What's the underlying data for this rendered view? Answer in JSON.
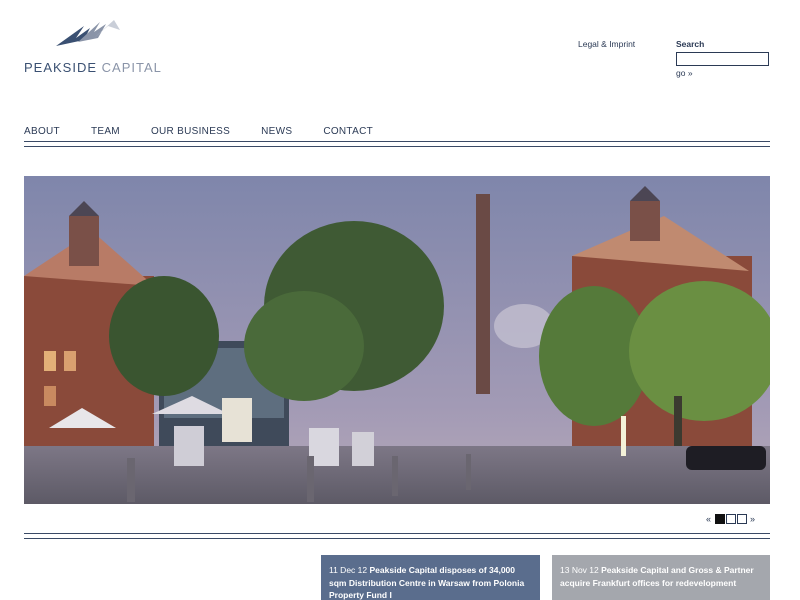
{
  "brand": {
    "name_main": "PEAKSIDE",
    "name_sub": "CAPITAL",
    "logo_icon": "mountain-peaks-icon",
    "colors": {
      "primary": "#3a5072",
      "secondary": "#8a94a8"
    }
  },
  "utility": {
    "legal_label": "Legal & Imprint",
    "search_label": "Search",
    "search_value": "",
    "go_label": "go »"
  },
  "nav": {
    "items": [
      {
        "label": "ABOUT"
      },
      {
        "label": "TEAM"
      },
      {
        "label": "OUR BUSINESS"
      },
      {
        "label": "NEWS"
      },
      {
        "label": "CONTACT"
      }
    ]
  },
  "hero": {
    "image_icon": "hero-photo",
    "slide_count": 3,
    "active_slide": 1
  },
  "pager": {
    "prev_label": "«",
    "next_label": "»"
  },
  "news": [
    {
      "date": "11 Dec 12",
      "title": "Peakside Capital disposes of 34,000 sqm Distribution Centre in Warsaw from Polonia Property Fund I",
      "color": "#5a6d8d"
    },
    {
      "date": "13 Nov 12",
      "title": "Peakside Capital and Gross & Partner acquire Frankfurt offices for redevelopment",
      "color": "#a4a7ad"
    }
  ]
}
